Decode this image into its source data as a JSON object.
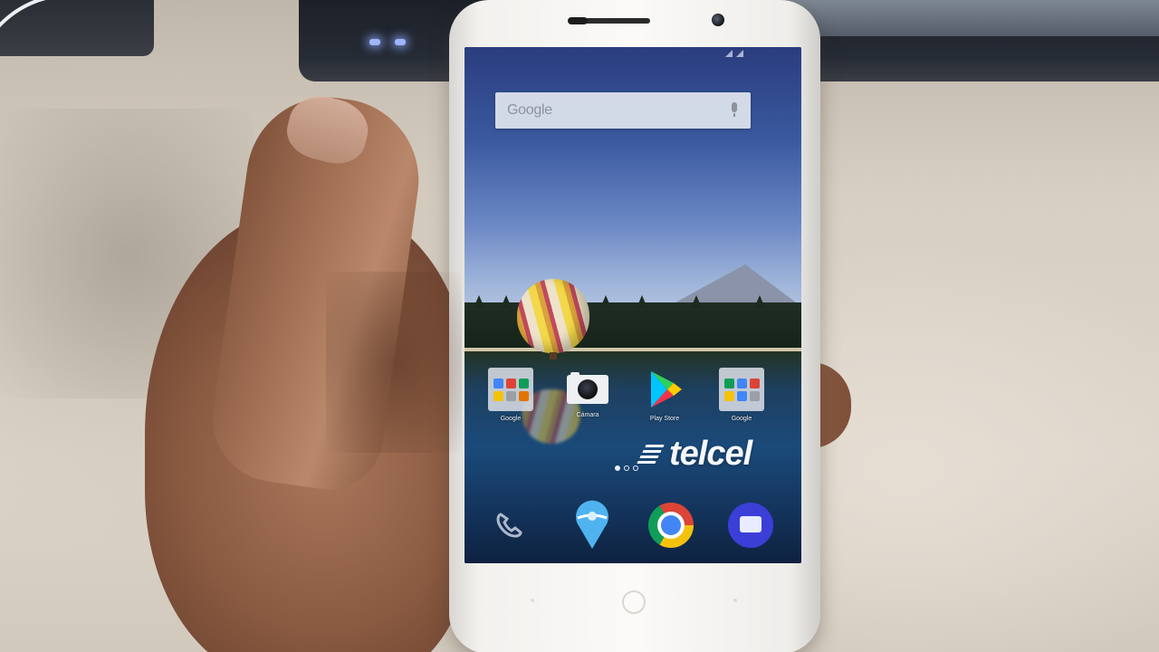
{
  "scene": {
    "description_colors": {
      "desk": "#d9d1c6",
      "phone_body": "#f3f1ee",
      "skin": "#a8765a"
    }
  },
  "phone": {
    "search_bar": {
      "logo_text": "Google",
      "mic_icon": "mic-icon"
    },
    "apps": [
      {
        "label": "Google",
        "icon": "folder-icon"
      },
      {
        "label": "Cámara",
        "icon": "camera-icon"
      },
      {
        "label": "Play Store",
        "icon": "play-store-icon"
      },
      {
        "label": "Google",
        "icon": "folder-icon"
      }
    ],
    "page_indicator": {
      "count": 3,
      "active_index": 0
    },
    "carrier_logo": {
      "text": "telcel"
    },
    "dock": [
      {
        "icon": "phone-icon"
      },
      {
        "icon": "maps-pin-icon"
      },
      {
        "icon": "chrome-icon"
      },
      {
        "icon": "messages-icon"
      }
    ],
    "colors": {
      "sky_top": "#2a3d7e",
      "water": "#1a4a7a",
      "chrome_red": "#db4437",
      "chrome_yellow": "#f4c20d",
      "chrome_green": "#0f9d58",
      "chrome_blue": "#4285f4",
      "messages_blue": "#3b3fd8"
    }
  }
}
